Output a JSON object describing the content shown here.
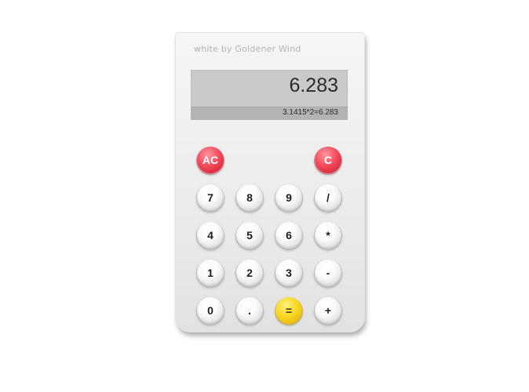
{
  "calculator": {
    "brand": "white by Goldener Wind",
    "display": {
      "result": "6.283",
      "expression": "3.1415*2=6.283"
    },
    "keys": {
      "ac": "AC",
      "c": "C",
      "seven": "7",
      "eight": "8",
      "nine": "9",
      "divide": "/",
      "four": "4",
      "five": "5",
      "six": "6",
      "multiply": "*",
      "one": "1",
      "two": "2",
      "three": "3",
      "minus": "-",
      "zero": "0",
      "dot": ".",
      "equals": "=",
      "plus": "+"
    }
  },
  "colors": {
    "body": "#efefef",
    "display": "#c9c9c9",
    "display_bar": "#b3b3b3",
    "clear_keys": "#ee3f50",
    "equals_key": "#f2cc1a"
  }
}
